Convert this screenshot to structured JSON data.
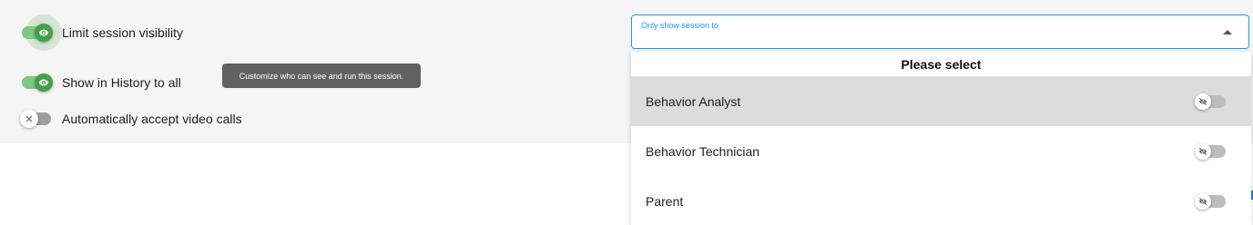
{
  "settings": {
    "limit_visibility": {
      "label": "Limit session visibility",
      "enabled": true,
      "icon": "eye-icon"
    },
    "show_in_history": {
      "label": "Show in History to all",
      "enabled": true,
      "icon": "eye-icon"
    },
    "auto_accept_video": {
      "label": "Automatically accept video calls",
      "enabled": false,
      "icon": "close-icon"
    }
  },
  "tooltip": {
    "text": "Customize who can see and run this session."
  },
  "visibility_select": {
    "label": "Only show session to",
    "dropdown_header": "Please select",
    "options": [
      {
        "label": "Behavior Analyst",
        "enabled": false,
        "highlighted": true,
        "icon": "eye-off-icon"
      },
      {
        "label": "Behavior Technician",
        "enabled": false,
        "highlighted": false,
        "icon": "eye-off-icon"
      },
      {
        "label": "Parent",
        "enabled": false,
        "highlighted": false,
        "icon": "eye-off-icon"
      }
    ]
  },
  "colors": {
    "accent_green": "#43a047",
    "accent_blue": "#2196f3",
    "panel_bg": "#f5f5f5",
    "highlight_bg": "#dcdcdc",
    "tooltip_bg": "#616161"
  }
}
